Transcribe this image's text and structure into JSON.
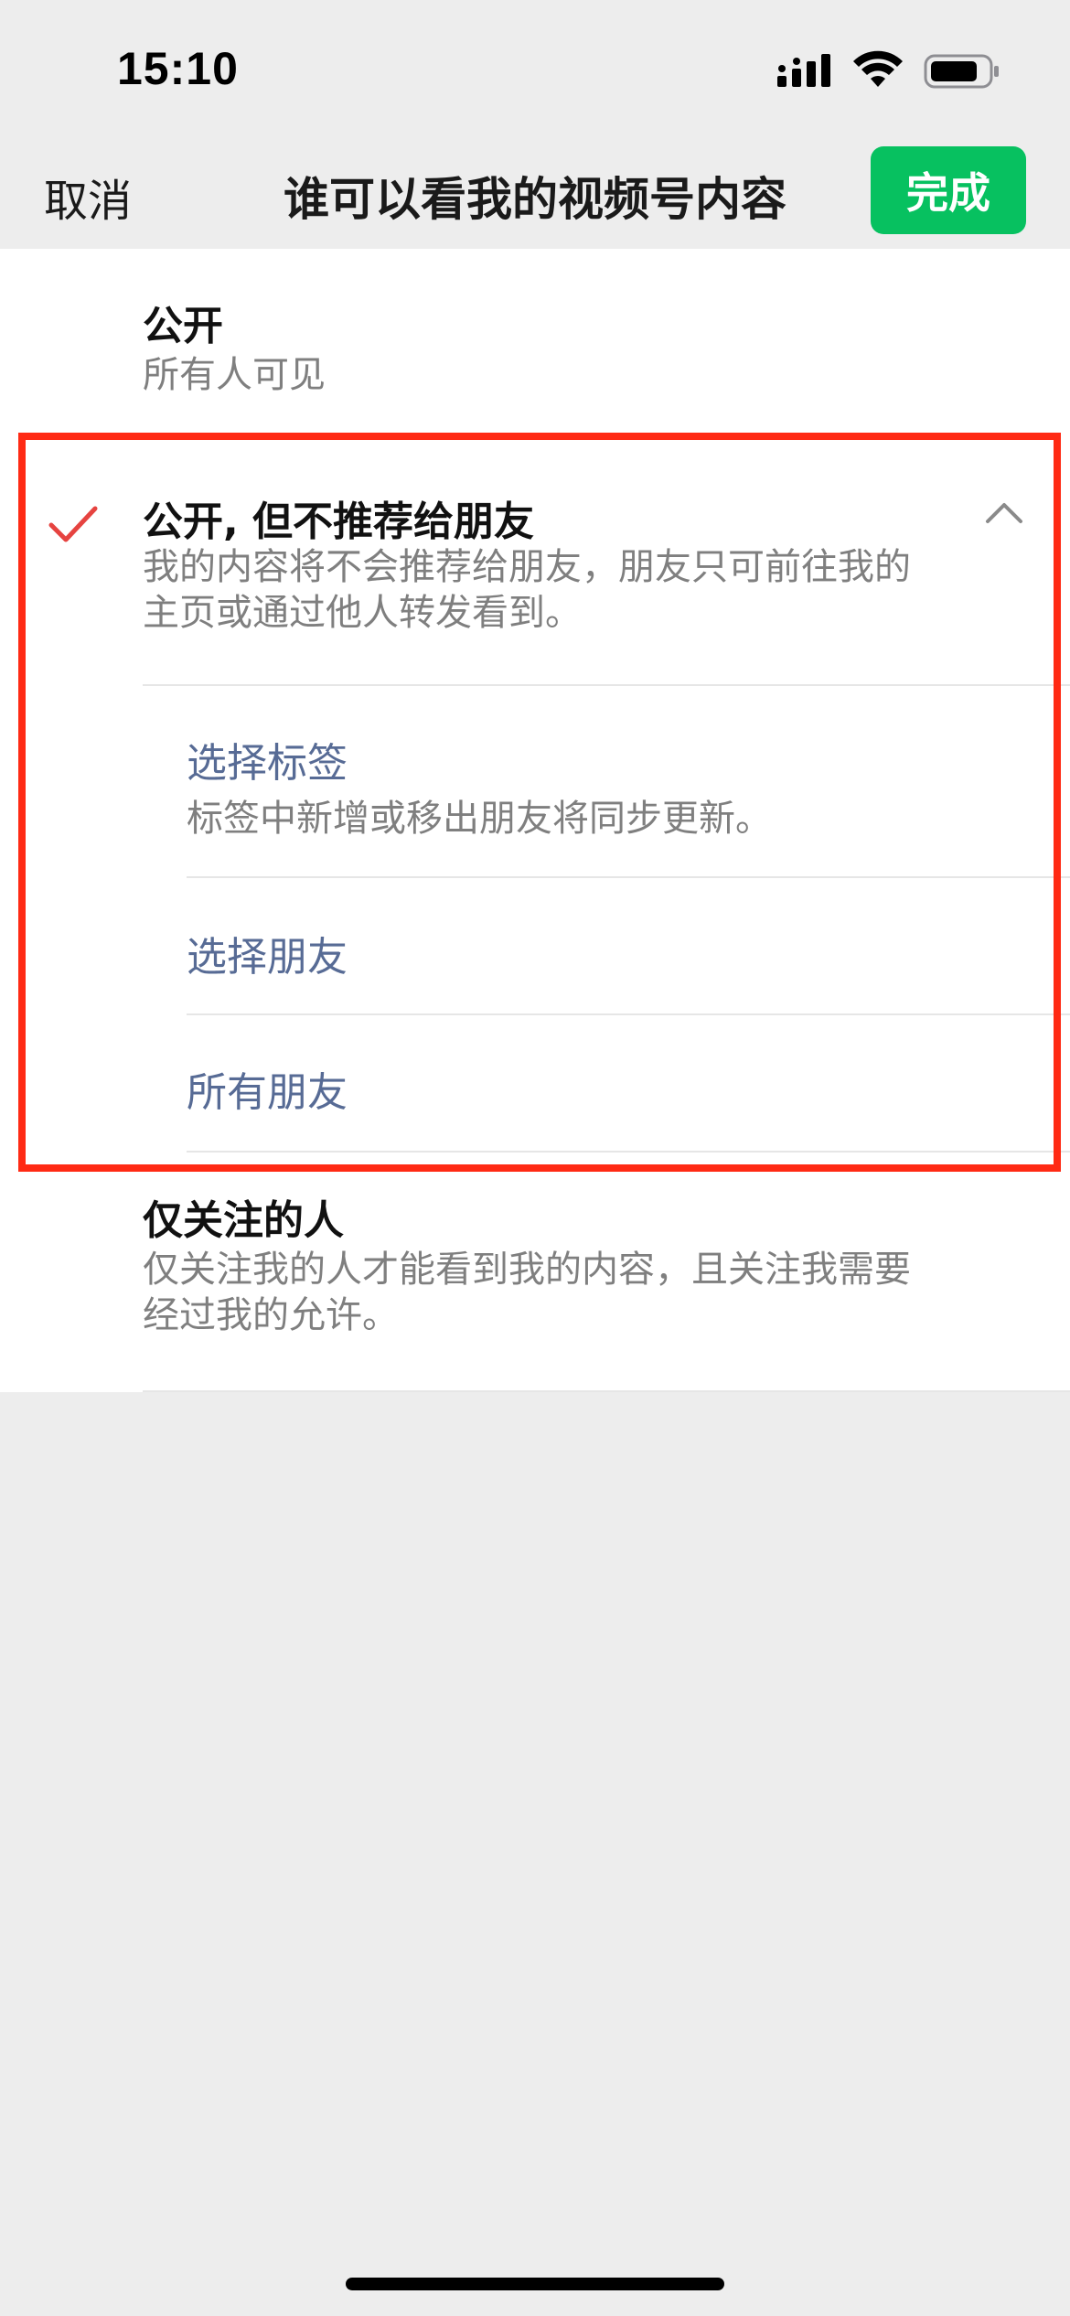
{
  "status_bar": {
    "time": "15:10",
    "icons": [
      "signal-icon",
      "wifi-icon",
      "battery-icon"
    ]
  },
  "nav": {
    "cancel_label": "取消",
    "title": "谁可以看我的视频号内容",
    "done_label": "完成",
    "done_color": "#07c160"
  },
  "options": [
    {
      "title": "公开",
      "desc": "所有人可见",
      "selected": false
    },
    {
      "title": "公开, 但不推荐给朋友",
      "desc_line1": "我的内容将不会推荐给朋友，朋友只可前往我的",
      "desc_line2": "主页或通过他人转发看到。",
      "selected": true,
      "expanded": true,
      "sub_options": [
        {
          "title": "选择标签",
          "desc": "标签中新增或移出朋友将同步更新。"
        },
        {
          "title": "选择朋友"
        },
        {
          "title": "所有朋友"
        }
      ]
    },
    {
      "title": "仅关注的人",
      "desc_line1": "仅关注我的人才能看到我的内容，且关注我需要",
      "desc_line2": "经过我的允许。",
      "selected": false
    }
  ],
  "colors": {
    "accent_green": "#07c160",
    "link_blue": "#576b95",
    "check_red": "#e64340",
    "highlight_red": "#ff2a14"
  }
}
